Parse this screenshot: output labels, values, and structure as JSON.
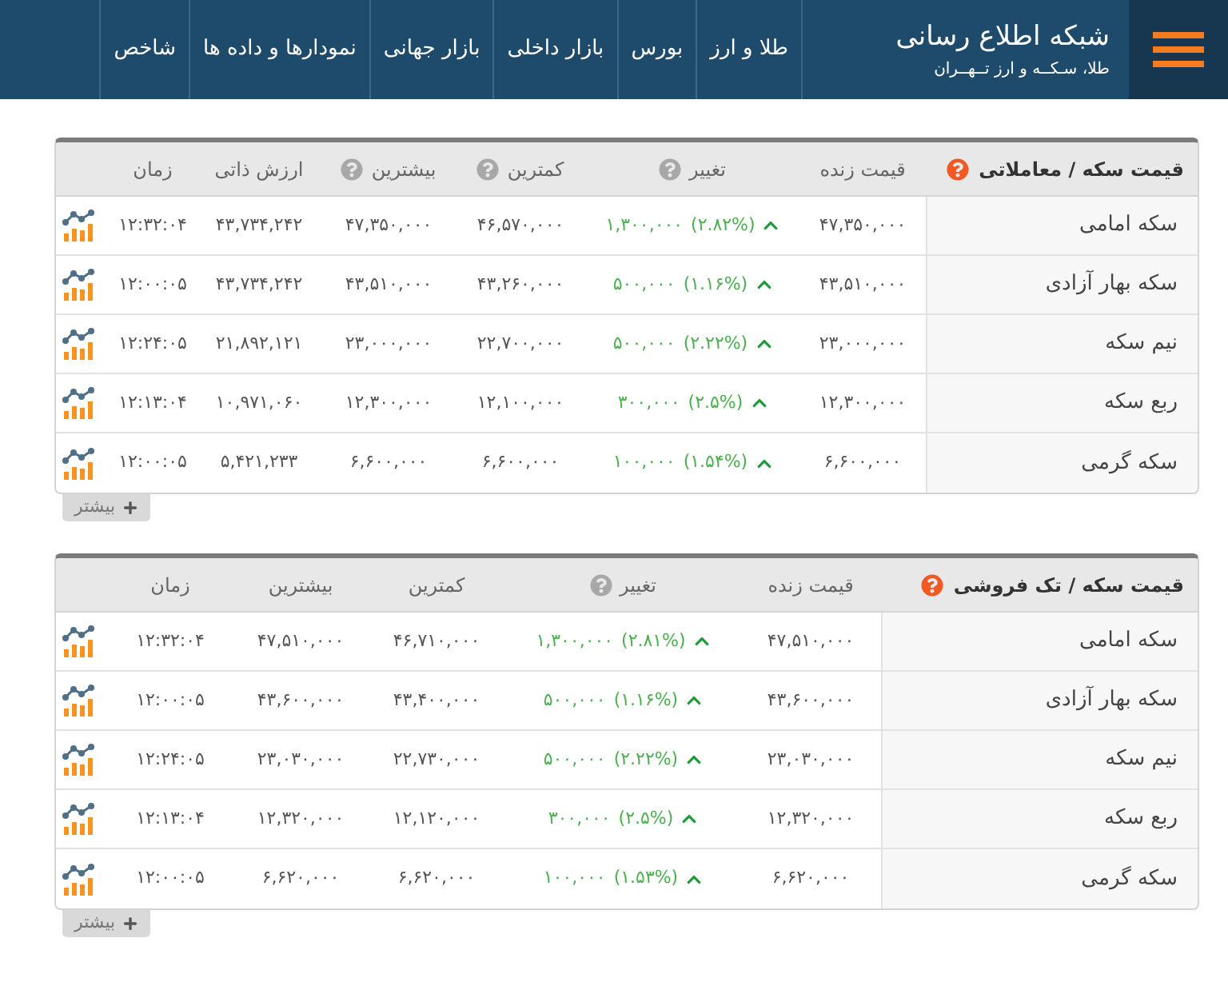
{
  "header": {
    "brand_title": "شبکه اطلاع رسانی",
    "brand_subtitle": "طلا، سـکــه و ارز تــهــران",
    "nav": [
      {
        "label": "طلا و ارز"
      },
      {
        "label": "بورس"
      },
      {
        "label": "بازار داخلی"
      },
      {
        "label": "بازار جهانی"
      },
      {
        "label": "نمودارها و داده ها"
      },
      {
        "label": "شاخص"
      }
    ]
  },
  "tables": [
    {
      "title": "قیمت سکه / معاملاتی",
      "help": true,
      "columns": [
        {
          "label": "قیمت زنده",
          "help": false
        },
        {
          "label": "تغییر",
          "help": true
        },
        {
          "label": "کمترین",
          "help": true
        },
        {
          "label": "بیشترین",
          "help": true
        },
        {
          "label": "ارزش ذاتی",
          "help": false
        },
        {
          "label": "زمان",
          "help": false
        }
      ],
      "rows": [
        {
          "name": "سکه امامی",
          "price": "۴۷,۳۵۰,۰۰۰",
          "rising": true,
          "change_percent": "(۲.۸۲%)",
          "change_amount": "۱,۳۰۰,۰۰۰",
          "low": "۴۶,۵۷۰,۰۰۰",
          "high": "۴۷,۳۵۰,۰۰۰",
          "intrinsic_value": "۴۳,۷۳۴,۲۴۲",
          "time": "۱۲:۳۲:۰۴"
        },
        {
          "name": "سکه بهار آزادی",
          "price": "۴۳,۵۱۰,۰۰۰",
          "rising": true,
          "change_percent": "(۱.۱۶%)",
          "change_amount": "۵۰۰,۰۰۰",
          "low": "۴۳,۲۶۰,۰۰۰",
          "high": "۴۳,۵۱۰,۰۰۰",
          "intrinsic_value": "۴۳,۷۳۴,۲۴۲",
          "time": "۱۲:۰۰:۰۵"
        },
        {
          "name": "نیم سکه",
          "price": "۲۳,۰۰۰,۰۰۰",
          "rising": true,
          "change_percent": "(۲.۲۲%)",
          "change_amount": "۵۰۰,۰۰۰",
          "low": "۲۲,۷۰۰,۰۰۰",
          "high": "۲۳,۰۰۰,۰۰۰",
          "intrinsic_value": "۲۱,۸۹۲,۱۲۱",
          "time": "۱۲:۲۴:۰۵"
        },
        {
          "name": "ربع سکه",
          "price": "۱۲,۳۰۰,۰۰۰",
          "rising": true,
          "change_percent": "(۲.۵%)",
          "change_amount": "۳۰۰,۰۰۰",
          "low": "۱۲,۱۰۰,۰۰۰",
          "high": "۱۲,۳۰۰,۰۰۰",
          "intrinsic_value": "۱۰,۹۷۱,۰۶۰",
          "time": "۱۲:۱۳:۰۴"
        },
        {
          "name": "سکه گرمی",
          "price": "۶,۶۰۰,۰۰۰",
          "rising": true,
          "change_percent": "(۱.۵۴%)",
          "change_amount": "۱۰۰,۰۰۰",
          "low": "۶,۶۰۰,۰۰۰",
          "high": "۶,۶۰۰,۰۰۰",
          "intrinsic_value": "۵,۴۲۱,۲۳۳",
          "time": "۱۲:۰۰:۰۵"
        }
      ],
      "more_label": "بیشتر"
    },
    {
      "title": "قیمت سکه / تک فروشی",
      "help": true,
      "columns": [
        {
          "label": "قیمت زنده",
          "help": false
        },
        {
          "label": "تغییر",
          "help": true
        },
        {
          "label": "کمترین",
          "help": false
        },
        {
          "label": "بیشترین",
          "help": false
        },
        {
          "label": "زمان",
          "help": false
        }
      ],
      "rows": [
        {
          "name": "سکه امامی",
          "price": "۴۷,۵۱۰,۰۰۰",
          "rising": true,
          "change_percent": "(۲.۸۱%)",
          "change_amount": "۱,۳۰۰,۰۰۰",
          "low": "۴۶,۷۱۰,۰۰۰",
          "high": "۴۷,۵۱۰,۰۰۰",
          "time": "۱۲:۳۲:۰۴"
        },
        {
          "name": "سکه بهار آزادی",
          "price": "۴۳,۶۰۰,۰۰۰",
          "rising": true,
          "change_percent": "(۱.۱۶%)",
          "change_amount": "۵۰۰,۰۰۰",
          "low": "۴۳,۴۰۰,۰۰۰",
          "high": "۴۳,۶۰۰,۰۰۰",
          "time": "۱۲:۰۰:۰۵"
        },
        {
          "name": "نیم سکه",
          "price": "۲۳,۰۳۰,۰۰۰",
          "rising": true,
          "change_percent": "(۲.۲۲%)",
          "change_amount": "۵۰۰,۰۰۰",
          "low": "۲۲,۷۳۰,۰۰۰",
          "high": "۲۳,۰۳۰,۰۰۰",
          "time": "۱۲:۲۴:۰۵"
        },
        {
          "name": "ربع سکه",
          "price": "۱۲,۳۲۰,۰۰۰",
          "rising": true,
          "change_percent": "(۲.۵%)",
          "change_amount": "۳۰۰,۰۰۰",
          "low": "۱۲,۱۲۰,۰۰۰",
          "high": "۱۲,۳۲۰,۰۰۰",
          "time": "۱۲:۱۳:۰۴"
        },
        {
          "name": "سکه گرمی",
          "price": "۶,۶۲۰,۰۰۰",
          "rising": true,
          "change_percent": "(۱.۵۳%)",
          "change_amount": "۱۰۰,۰۰۰",
          "low": "۶,۶۲۰,۰۰۰",
          "high": "۶,۶۲۰,۰۰۰",
          "time": "۱۲:۰۰:۰۵"
        }
      ],
      "more_label": "بیشتر"
    }
  ]
}
